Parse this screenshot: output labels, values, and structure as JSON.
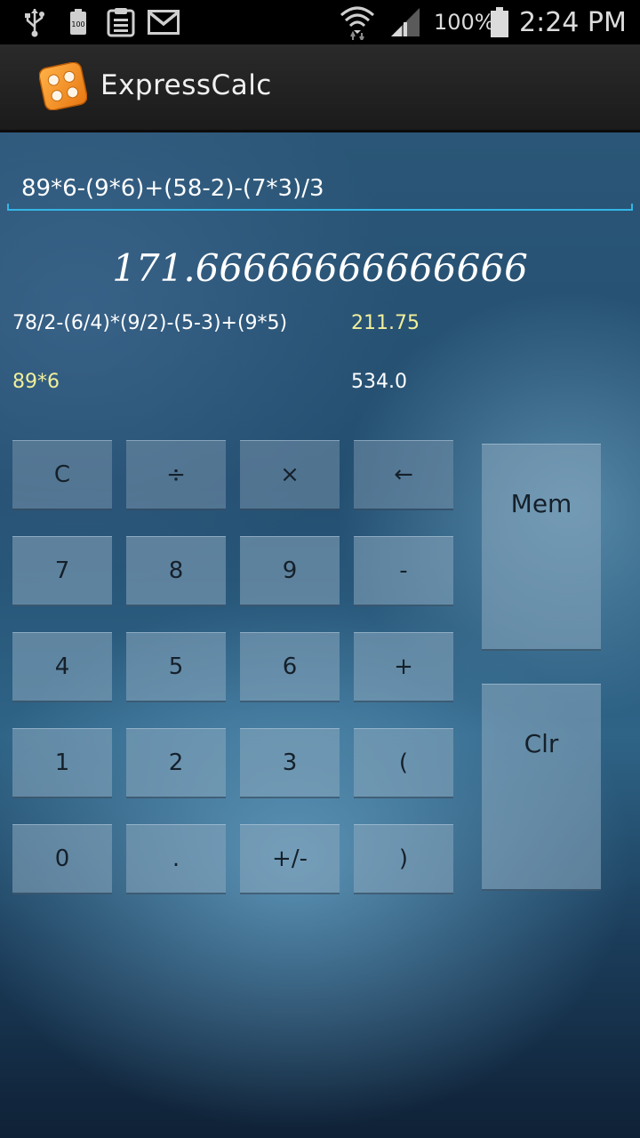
{
  "status_bar": {
    "battery_percent": "100%",
    "time": "2:24 PM",
    "battery_icon_label": "100"
  },
  "app": {
    "title": "ExpressCalc"
  },
  "expression_input": {
    "value": "89*6-(9*6)+(58-2)-(7*3)/3"
  },
  "result": "171.66666666666666",
  "history": [
    {
      "expression": "78/2-(6/4)*(9/2)-(5-3)+(9*5)",
      "value": "211.75"
    },
    {
      "expression": "89*6",
      "value": "534.0"
    }
  ],
  "keys": {
    "clear_entry": "C",
    "divide": "÷",
    "multiply": "×",
    "backspace": "←",
    "seven": "7",
    "eight": "8",
    "nine": "9",
    "minus": "-",
    "four": "4",
    "five": "5",
    "six": "6",
    "plus": "+",
    "one": "1",
    "two": "2",
    "three": "3",
    "open_paren": "(",
    "zero": "0",
    "dot": ".",
    "sign": "+/-",
    "close_paren": ")",
    "mem": "Mem",
    "clr": "Clr"
  },
  "colors": {
    "accent": "#33b5e5",
    "history_highlight": "#f2ef9a"
  },
  "icons": [
    "usb-icon",
    "battery-small-icon",
    "clipboard-icon",
    "gmail-icon",
    "wifi-icon",
    "signal-icon",
    "battery-icon",
    "calculator-app-icon"
  ]
}
